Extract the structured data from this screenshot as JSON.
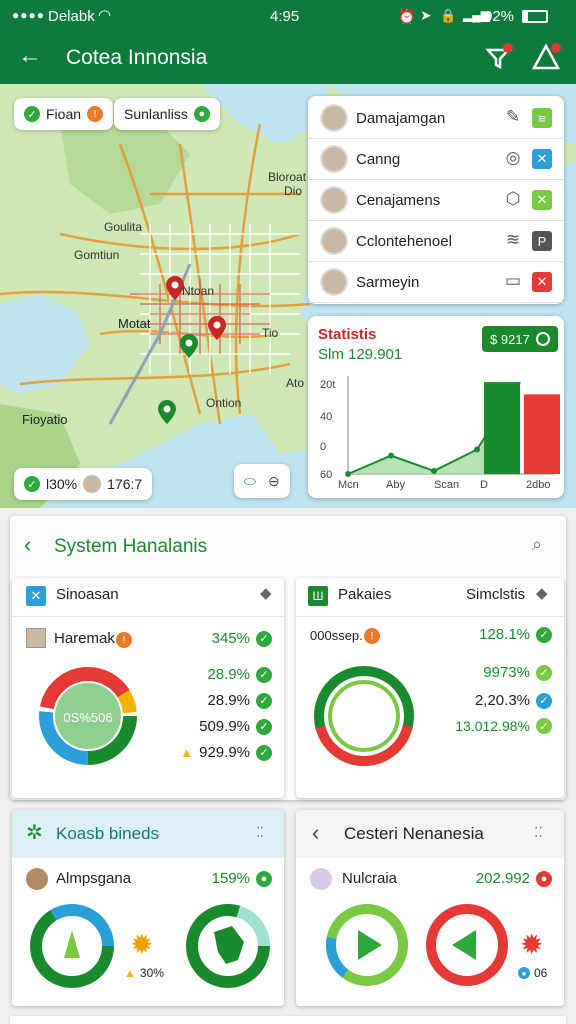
{
  "status": {
    "carrier": "Delabk",
    "time": "4:95",
    "battery": "02%"
  },
  "appbar": {
    "title": "Cotea Innonsia"
  },
  "map": {
    "chip_left": "Fioan",
    "chip_right": "Sunlanliss",
    "labels": [
      "Bloroat",
      "Dio",
      "Goulita",
      "Gomtiun",
      "Ntoan",
      "Motat",
      "Tio",
      "Ontion",
      "Fioyatio",
      "Ato"
    ],
    "bottom_chip_value": "l30%",
    "bottom_chip_number": "176:7"
  },
  "user_list": [
    {
      "name": "Damajamgan",
      "icon": "pen-icon",
      "badge_color": "#7ac943",
      "badge_icon": "list-icon"
    },
    {
      "name": "Canng",
      "icon": "target-icon",
      "badge_color": "#2b9fd8",
      "badge_icon": "close-icon"
    },
    {
      "name": "Cenajamens",
      "icon": "tag-icon",
      "badge_color": "#7ac943",
      "badge_icon": "close-icon"
    },
    {
      "name": "Cclontehenoel",
      "icon": "wave-icon",
      "badge_color": "#555555",
      "badge_icon": "p-icon"
    },
    {
      "name": "Sarmeyin",
      "icon": "video-icon",
      "badge_color": "#e53935",
      "badge_icon": "close-icon"
    }
  ],
  "statistics": {
    "title": "Statistis",
    "subtitle": "Slm 129.901",
    "badge": "$ 9217",
    "chart_data": {
      "type": "line",
      "title": "Statistis",
      "y_tick_labels": [
        "20t",
        "40",
        "0",
        "60"
      ],
      "x_tick_labels": [
        "Mcn",
        "Aby",
        "Scan",
        "D",
        "2dbo"
      ],
      "line": {
        "x": [
          0,
          1,
          2,
          3,
          4
        ],
        "y": [
          0,
          30,
          5,
          40,
          150
        ]
      },
      "bars": [
        {
          "category": "D",
          "value": 150,
          "color": "#1a8a2e"
        },
        {
          "category": "2dbo",
          "value": 130,
          "color": "#e53935"
        }
      ]
    }
  },
  "panel": {
    "title": "System Hanalanis",
    "left": {
      "header": "Sinoasan",
      "row_title": "Haremak",
      "row_value": "345%",
      "donut_center": "0S%506",
      "values": [
        "28.9%",
        "28.9%",
        "509.9%",
        "929.9%"
      ]
    },
    "right": {
      "header": "Pakaies",
      "header_right": "Simclstis",
      "row_title": "000ssep.",
      "row_value": "128.1%",
      "values": [
        "9973%",
        "2,20.3%",
        "13.012.98%"
      ]
    }
  },
  "bottom": {
    "left": {
      "title": "Koasb bineds",
      "row_title": "Almpsgana",
      "row_value": "159%",
      "warn_value": "30%"
    },
    "right": {
      "title": "Cesteri Nenanesia",
      "row_title": "Nulcraia",
      "row_value": "202.992",
      "small_value": "06"
    }
  },
  "colors": {
    "brand": "#0e7a3e",
    "accent_green": "#2eaa3c",
    "red": "#e53935",
    "blue": "#2b9fd8"
  }
}
